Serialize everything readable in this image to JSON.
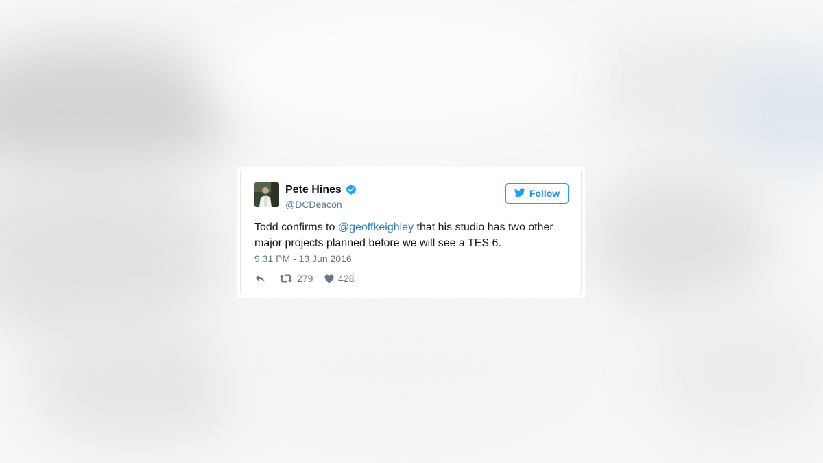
{
  "tweet": {
    "author_name": "Pete Hines",
    "author_handle": "@DCDeacon",
    "follow_label": "Follow",
    "text_before": "Todd confirms to ",
    "mention": "@geoffkeighley",
    "text_after": " that his studio has two other major projects planned before we will see a TES 6.",
    "timestamp": "9:31 PM - 13 Jun 2016",
    "retweet_count": "279",
    "like_count": "428"
  },
  "icons": {
    "verified": "verified-badge-icon",
    "bird": "twitter-bird-icon",
    "reply": "reply-icon",
    "retweet": "retweet-icon",
    "like": "heart-icon"
  },
  "colors": {
    "accent": "#1da1f2",
    "link": "#2b7bb9",
    "text": "#14171a",
    "muted": "#657786",
    "border": "#e1e8ed"
  }
}
